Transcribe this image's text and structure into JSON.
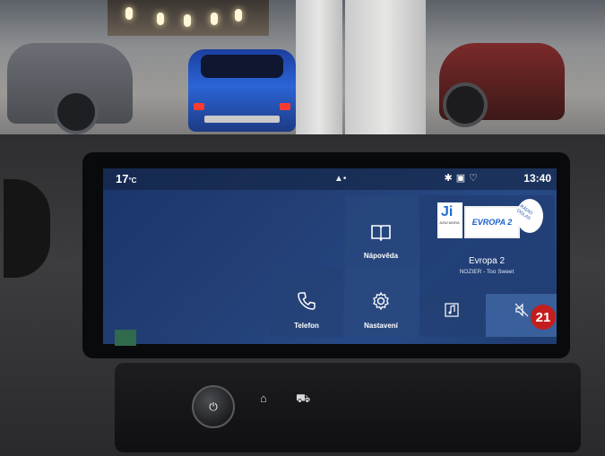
{
  "status": {
    "temperature": "17",
    "temperature_unit": "°C",
    "time": "13:40",
    "icons": [
      "bluetooth-icon",
      "car-icon",
      "signal-icon"
    ]
  },
  "tiles": {
    "help_label": "Nápověda",
    "phone_label": "Telefon",
    "settings_label": "Nastavení"
  },
  "radio": {
    "station": "Evropa 2",
    "track": "NOZIER - Too Sweet",
    "logo_text": "EVROPA 2",
    "left_logo_text": "Ji",
    "left_logo_sub": "JIZNÍ MORA",
    "right_logo_text": "RÁDIO OGLAS"
  },
  "badge": "21",
  "colors": {
    "screen_bg": "#233f76",
    "badge": "#c41d1d",
    "car_blue": "#2b64d6"
  }
}
